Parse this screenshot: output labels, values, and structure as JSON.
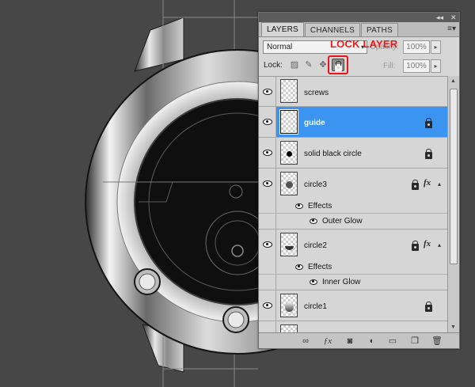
{
  "panel": {
    "controls": {
      "collapse": "◂◂",
      "close": "✕"
    },
    "tabs": [
      {
        "label": "LAYERS",
        "active": true
      },
      {
        "label": "CHANNELS",
        "active": false
      },
      {
        "label": "PATHS",
        "active": false
      }
    ],
    "menu_icon": "≡▾",
    "blend_mode": "Normal",
    "opacity_label": "Opacity:",
    "opacity_value": "100%",
    "lock_label": "Lock:",
    "fill_label": "Fill:",
    "fill_value": "100%",
    "callout": "LOCK LAYER",
    "callout_color": "#ee1b1b",
    "selection_color": "#3a94f0"
  },
  "layers": [
    {
      "name": "screws",
      "selected": false,
      "locked": false
    },
    {
      "name": "guide",
      "selected": true,
      "locked": true
    },
    {
      "name": "solid black circle",
      "selected": false,
      "locked": true
    },
    {
      "name": "circle3",
      "selected": false,
      "locked": true,
      "fx": "fx",
      "effects_label": "Effects",
      "effect": "Outer Glow"
    },
    {
      "name": "circle2",
      "selected": false,
      "locked": true,
      "fx": "fx",
      "effects_label": "Effects",
      "effect": "Inner Glow"
    },
    {
      "name": "circle1",
      "selected": false,
      "locked": true
    }
  ],
  "footer_icons": [
    "link-icon",
    "fx-icon",
    "mask-icon",
    "adjustment-icon",
    "folder-icon",
    "new-layer-icon",
    "trash-icon"
  ]
}
